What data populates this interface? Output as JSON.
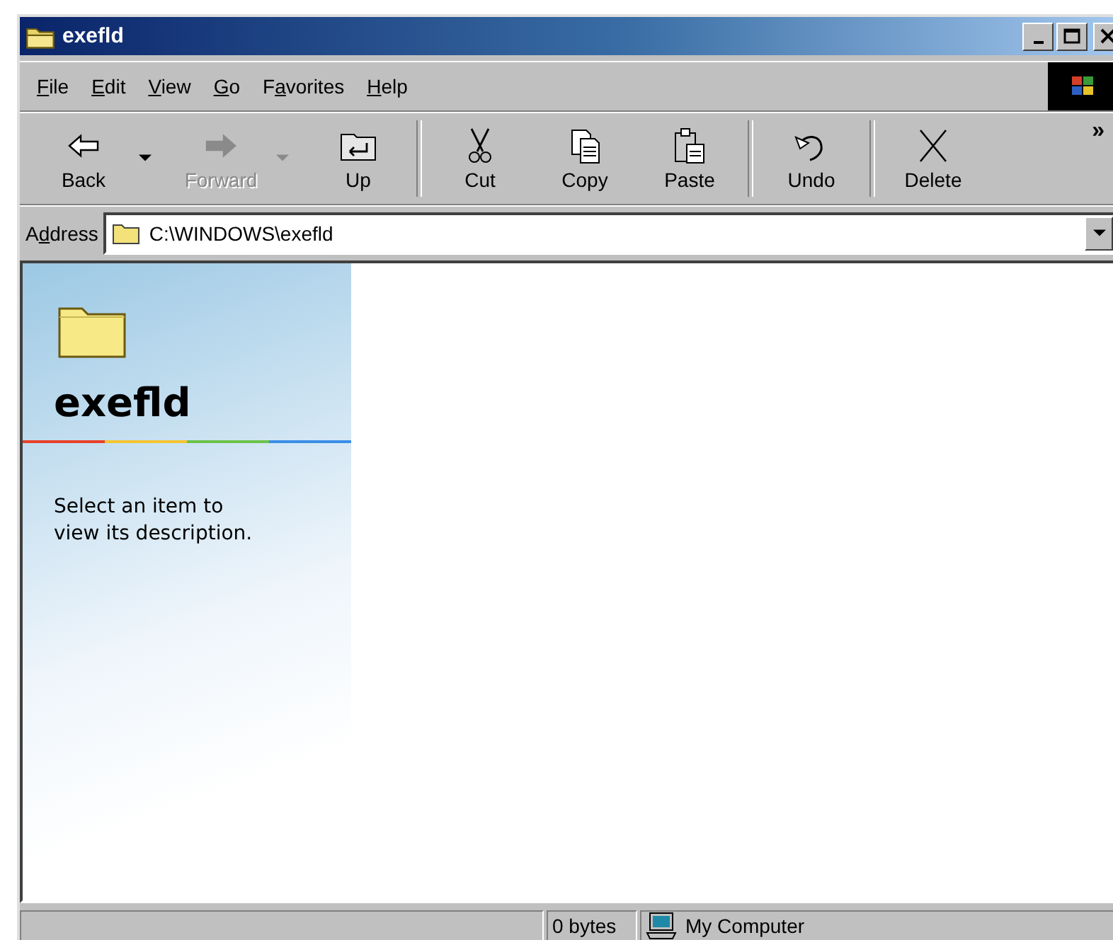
{
  "window": {
    "title": "exefld"
  },
  "menu": [
    {
      "key": "F",
      "post": "ile"
    },
    {
      "key": "E",
      "post": "dit"
    },
    {
      "key": "V",
      "post": "iew"
    },
    {
      "key": "G",
      "post": "o"
    },
    {
      "pre": "F",
      "key": "a",
      "post": "vorites"
    },
    {
      "key": "H",
      "post": "elp"
    }
  ],
  "toolbar": [
    {
      "kind": "back",
      "label": "Back",
      "disabled": false,
      "dropdown": true
    },
    {
      "kind": "forward",
      "label": "Forward",
      "disabled": true,
      "dropdown": true
    },
    {
      "kind": "up",
      "label": "Up",
      "disabled": false,
      "dropdown": false
    },
    {
      "kind": "separator"
    },
    {
      "kind": "cut",
      "label": "Cut",
      "disabled": false,
      "dropdown": false
    },
    {
      "kind": "copy",
      "label": "Copy",
      "disabled": false,
      "dropdown": false
    },
    {
      "kind": "paste",
      "label": "Paste",
      "disabled": false,
      "dropdown": false
    },
    {
      "kind": "separator"
    },
    {
      "kind": "undo",
      "label": "Undo",
      "disabled": false,
      "dropdown": false
    },
    {
      "kind": "separator"
    },
    {
      "kind": "delete",
      "label": "Delete",
      "disabled": false,
      "dropdown": false
    }
  ],
  "toolbar_more": "»",
  "address": {
    "pre": "A",
    "key": "d",
    "post": "dress",
    "value": "C:\\WINDOWS\\exefld"
  },
  "info_pane": {
    "title": "exefld",
    "description": "Select an item to view its description."
  },
  "status_bar": {
    "size": "0 bytes",
    "zone": "My Computer"
  }
}
